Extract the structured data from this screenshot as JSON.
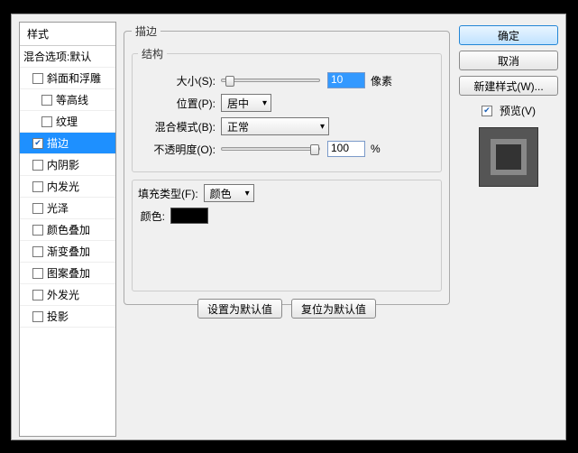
{
  "sidebar": {
    "header": "样式",
    "blending": "混合选项:默认",
    "items": [
      {
        "label": "斜面和浮雕",
        "checked": false,
        "indent": 0
      },
      {
        "label": "等高线",
        "checked": false,
        "indent": 1
      },
      {
        "label": "纹理",
        "checked": false,
        "indent": 1
      },
      {
        "label": "描边",
        "checked": true,
        "indent": 0,
        "selected": true
      },
      {
        "label": "内阴影",
        "checked": false,
        "indent": 0
      },
      {
        "label": "内发光",
        "checked": false,
        "indent": 0
      },
      {
        "label": "光泽",
        "checked": false,
        "indent": 0
      },
      {
        "label": "颜色叠加",
        "checked": false,
        "indent": 0
      },
      {
        "label": "渐变叠加",
        "checked": false,
        "indent": 0
      },
      {
        "label": "图案叠加",
        "checked": false,
        "indent": 0
      },
      {
        "label": "外发光",
        "checked": false,
        "indent": 0
      },
      {
        "label": "投影",
        "checked": false,
        "indent": 0
      }
    ]
  },
  "main": {
    "group_title": "描边",
    "structure_title": "结构",
    "size_label": "大小(S):",
    "size_value": "10",
    "size_unit": "像素",
    "position_label": "位置(P):",
    "position_value": "居中",
    "blend_label": "混合模式(B):",
    "blend_value": "正常",
    "opacity_label": "不透明度(O):",
    "opacity_value": "100",
    "opacity_unit": "%",
    "fill_label": "填充类型(F):",
    "fill_value": "颜色",
    "color_label": "颜色:",
    "color_value": "#000000",
    "set_default": "设置为默认值",
    "reset_default": "复位为默认值"
  },
  "side": {
    "ok": "确定",
    "cancel": "取消",
    "newstyle": "新建样式(W)...",
    "preview_label": "预览(V)",
    "preview_checked": true
  }
}
